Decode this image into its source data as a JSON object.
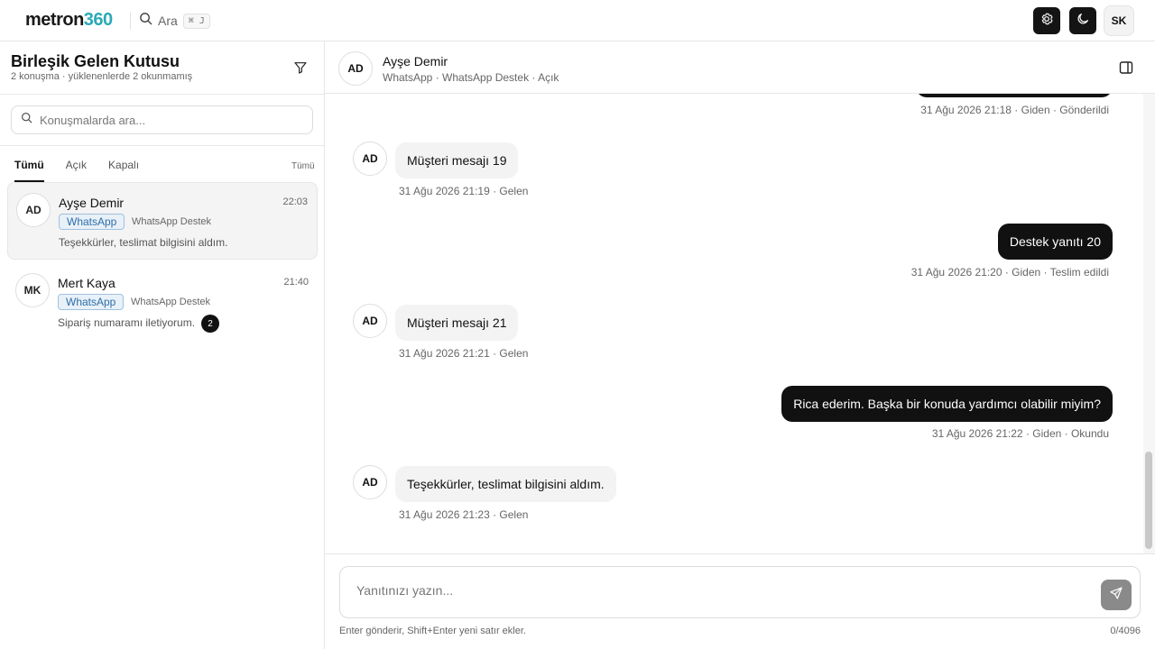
{
  "topbar": {
    "logo_text": "metron",
    "logo_num": "360",
    "search_label": "Ara",
    "search_shortcut": "⌘ J",
    "user_initials": "SK"
  },
  "sidebar": {
    "title": "Birleşik Gelen Kutusu",
    "subtitle": "2 konuşma · yüklenenlerde 2 okunmamış",
    "search_placeholder": "Konuşmalarda ara...",
    "tabs": [
      {
        "label": "Tümü",
        "active": true
      },
      {
        "label": "Açık",
        "active": false
      },
      {
        "label": "Kapalı",
        "active": false
      }
    ],
    "tab_right_label": "Tümü",
    "conversations": [
      {
        "initials": "AD",
        "name": "Ayşe Demir",
        "time": "22:03",
        "channel": "WhatsApp",
        "inbox": "WhatsApp Destek",
        "preview": "Teşekkürler, teslimat bilgisini aldım.",
        "unread": null
      },
      {
        "initials": "MK",
        "name": "Mert Kaya",
        "time": "21:40",
        "channel": "WhatsApp",
        "inbox": "WhatsApp Destek",
        "preview": "Sipariş numaramı iletiyorum.",
        "unread": "2"
      }
    ]
  },
  "chat": {
    "contact_initials": "AD",
    "contact_name": "Ayşe Demir",
    "contact_meta": "WhatsApp · WhatsApp Destek · Açık",
    "messages": [
      {
        "dir": "out",
        "text": "",
        "meta": "31 Ağu 2026 21:18 · Giden · Gönderildi"
      },
      {
        "dir": "in",
        "initials": "AD",
        "text": "Müşteri mesajı 19",
        "meta": "31 Ağu 2026 21:19 · Gelen"
      },
      {
        "dir": "out",
        "text": "Destek yanıtı 20",
        "meta": "31 Ağu 2026 21:20 · Giden · Teslim edildi"
      },
      {
        "dir": "in",
        "initials": "AD",
        "text": "Müşteri mesajı 21",
        "meta": "31 Ağu 2026 21:21 · Gelen"
      },
      {
        "dir": "out",
        "text": "Rica ederim. Başka bir konuda yardımcı olabilir miyim?",
        "meta": "31 Ağu 2026 21:22 · Giden · Okundu"
      },
      {
        "dir": "in",
        "initials": "AD",
        "text": "Teşekkürler, teslimat bilgisini aldım.",
        "meta": "31 Ağu 2026 21:23 · Gelen"
      }
    ]
  },
  "composer": {
    "placeholder": "Yanıtınızı yazın...",
    "hint": "Enter gönderir, Shift+Enter yeni satır ekler.",
    "counter": "0/4096"
  },
  "colors": {
    "brand_teal": "#2aa9b8",
    "outgoing_bubble": "#111111",
    "incoming_bubble": "#f3f3f3",
    "channel_badge": "#2f6fa8"
  }
}
